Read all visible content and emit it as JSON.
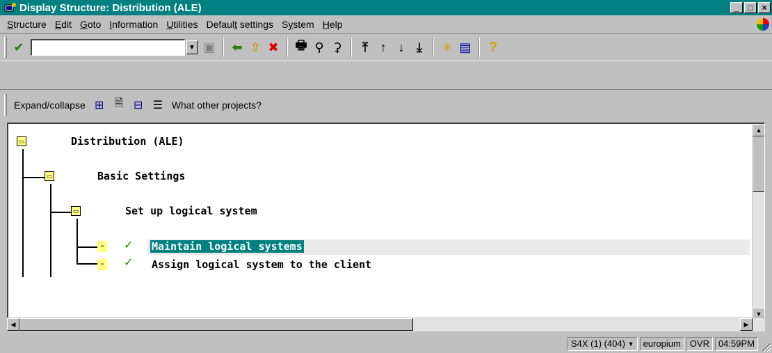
{
  "window": {
    "title": "Display Structure: Distribution (ALE)"
  },
  "menubar": {
    "items": [
      {
        "pre": "",
        "key": "S",
        "post": "tructure"
      },
      {
        "pre": "",
        "key": "E",
        "post": "dit"
      },
      {
        "pre": "",
        "key": "G",
        "post": "oto"
      },
      {
        "pre": "",
        "key": "I",
        "post": "nformation"
      },
      {
        "pre": "",
        "key": "U",
        "post": "tilities"
      },
      {
        "pre": "Defaul",
        "key": "t",
        "post": " settings"
      },
      {
        "pre": "S",
        "key": "y",
        "post": "stem"
      },
      {
        "pre": "",
        "key": "H",
        "post": "elp"
      }
    ]
  },
  "toolbar": {
    "command_value": ""
  },
  "apptoolbar": {
    "expand_label": "Expand/collapse",
    "projects_label": "What other projects?"
  },
  "tree": {
    "root": "Distribution (ALE)",
    "level1": "Basic Settings",
    "level2": "Set up logical system",
    "leaf1": "Maintain logical systems",
    "leaf2": "Assign logical system to the client"
  },
  "status": {
    "system": "S4X (1) (404)",
    "server": "europium",
    "mode": "OVR",
    "time": "04:59PM"
  }
}
